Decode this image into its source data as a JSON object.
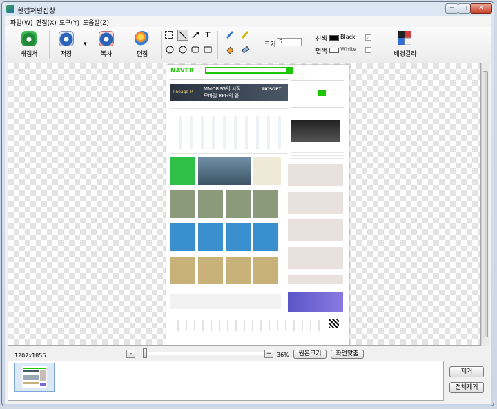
{
  "window": {
    "title": "한캡쳐편집창",
    "minimize": "─",
    "maximize": "□",
    "close": "✕"
  },
  "menu": [
    "파일(W)",
    "편집(X)",
    "도구(Y)",
    "도움말(Z)"
  ],
  "toolbar": {
    "new_capture": "새캡쳐",
    "save": "저장",
    "save_dropdown": "▾",
    "copy": "복사",
    "edit": "편집",
    "size_label": "크기",
    "size_value": "5",
    "line_label": "선색",
    "line_color_name": "Black",
    "fill_label": "면색",
    "fill_color_name": "White",
    "check_mark": "✓",
    "bg_color": "배경칼라"
  },
  "tools": {
    "text_tool": "T"
  },
  "document": {
    "logo": "NAVER",
    "banner_text": "MMORPG의 시작",
    "banner_sub": "모바일 RPG의 끝",
    "banner_brand": "TICSOFT",
    "banner_left": "lineage M"
  },
  "status": {
    "dimensions": "1207x1856",
    "zoom_minus": "-",
    "zoom_plus": "+",
    "zoom_level": "36%",
    "original_size": "원본크기",
    "fit_screen": "화면맞춤"
  },
  "side_buttons": {
    "remove": "제거",
    "remove_all": "전체제거"
  },
  "colors": {
    "naver_green": "#1ec800",
    "window_frame": "#cfd8e4"
  }
}
